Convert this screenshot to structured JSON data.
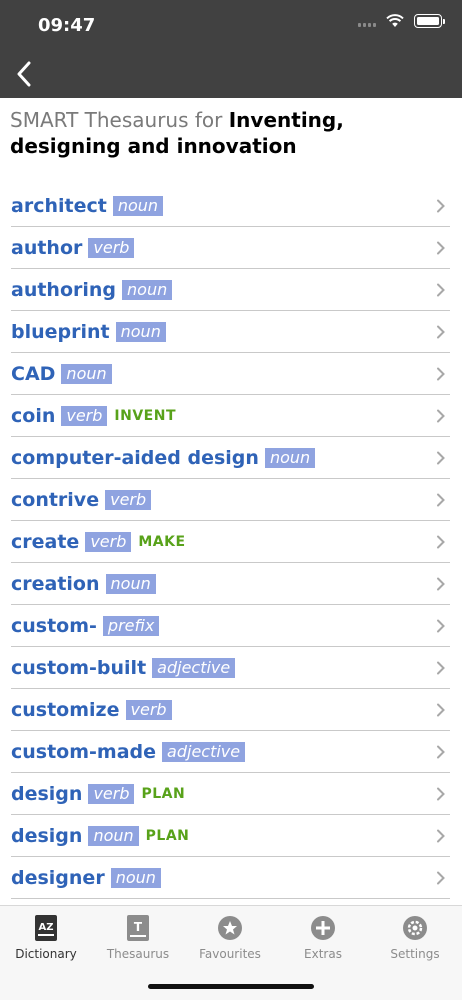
{
  "status": {
    "time": "09:47"
  },
  "header": {
    "title_prefix": "SMART Thesaurus for ",
    "title_bold": "Inventing, designing and innovation"
  },
  "entries": [
    {
      "word": "architect",
      "pos": "noun",
      "guide": ""
    },
    {
      "word": "author",
      "pos": "verb",
      "guide": ""
    },
    {
      "word": "authoring",
      "pos": "noun",
      "guide": ""
    },
    {
      "word": "blueprint",
      "pos": "noun",
      "guide": ""
    },
    {
      "word": "CAD",
      "pos": "noun",
      "guide": ""
    },
    {
      "word": "coin",
      "pos": "verb",
      "guide": "INVENT"
    },
    {
      "word": "computer-aided design",
      "pos": "noun",
      "guide": ""
    },
    {
      "word": "contrive",
      "pos": "verb",
      "guide": ""
    },
    {
      "word": "create",
      "pos": "verb",
      "guide": "MAKE"
    },
    {
      "word": "creation",
      "pos": "noun",
      "guide": ""
    },
    {
      "word": "custom-",
      "pos": "prefix",
      "guide": ""
    },
    {
      "word": "custom-built",
      "pos": "adjective",
      "guide": ""
    },
    {
      "word": "customize",
      "pos": "verb",
      "guide": ""
    },
    {
      "word": "custom-made",
      "pos": "adjective",
      "guide": ""
    },
    {
      "word": "design",
      "pos": "verb",
      "guide": "PLAN"
    },
    {
      "word": "design",
      "pos": "noun",
      "guide": "PLAN"
    },
    {
      "word": "designer",
      "pos": "noun",
      "guide": ""
    }
  ],
  "tabs": [
    {
      "label": "Dictionary",
      "icon": "dictionary-icon",
      "active": true
    },
    {
      "label": "Thesaurus",
      "icon": "thesaurus-icon",
      "active": false
    },
    {
      "label": "Favourites",
      "icon": "star-icon",
      "active": false
    },
    {
      "label": "Extras",
      "icon": "plus-icon",
      "active": false
    },
    {
      "label": "Settings",
      "icon": "gear-icon",
      "active": false
    }
  ],
  "colors": {
    "header_bg": "#414141",
    "word": "#2f63b7",
    "pos_badge_bg": "#8fa3e0",
    "guide_word": "#58a21a",
    "tab_inactive": "#8c8c8c"
  }
}
